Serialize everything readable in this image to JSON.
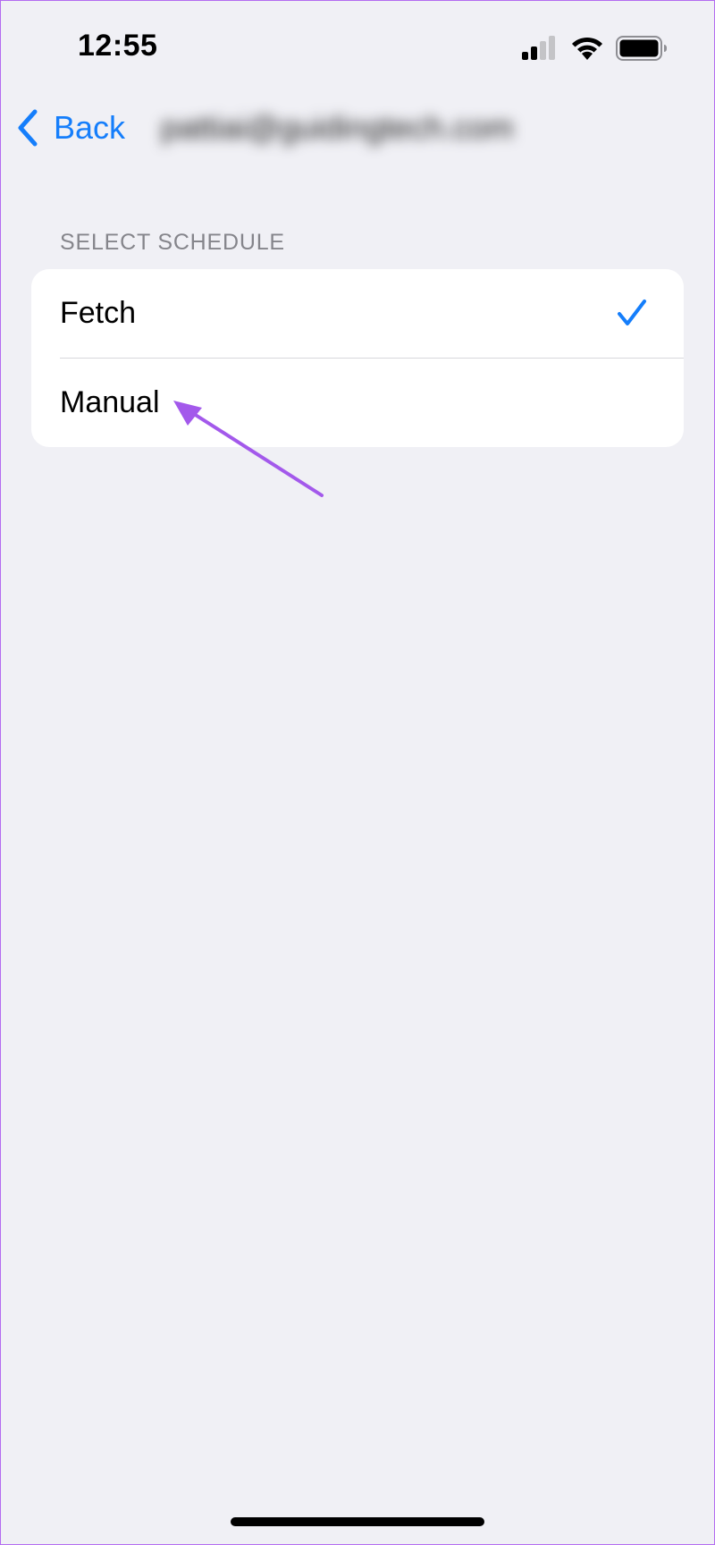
{
  "status_bar": {
    "time": "12:55",
    "signal_icon": "cellular-signal-icon",
    "wifi_icon": "wifi-icon",
    "battery_icon": "battery-icon"
  },
  "nav": {
    "back_label": "Back",
    "back_icon": "chevron-left-icon",
    "title": "pattiai@guidingtech.com",
    "title_obscured": true
  },
  "section": {
    "header": "SELECT SCHEDULE",
    "options": [
      {
        "label": "Fetch",
        "selected": true
      },
      {
        "label": "Manual",
        "selected": false
      }
    ]
  },
  "annotation": {
    "icon": "annotation-arrow",
    "color": "#a359eb"
  },
  "colors": {
    "accent": "#157efb",
    "background": "#f0f0f5",
    "section_header": "#85858b"
  }
}
